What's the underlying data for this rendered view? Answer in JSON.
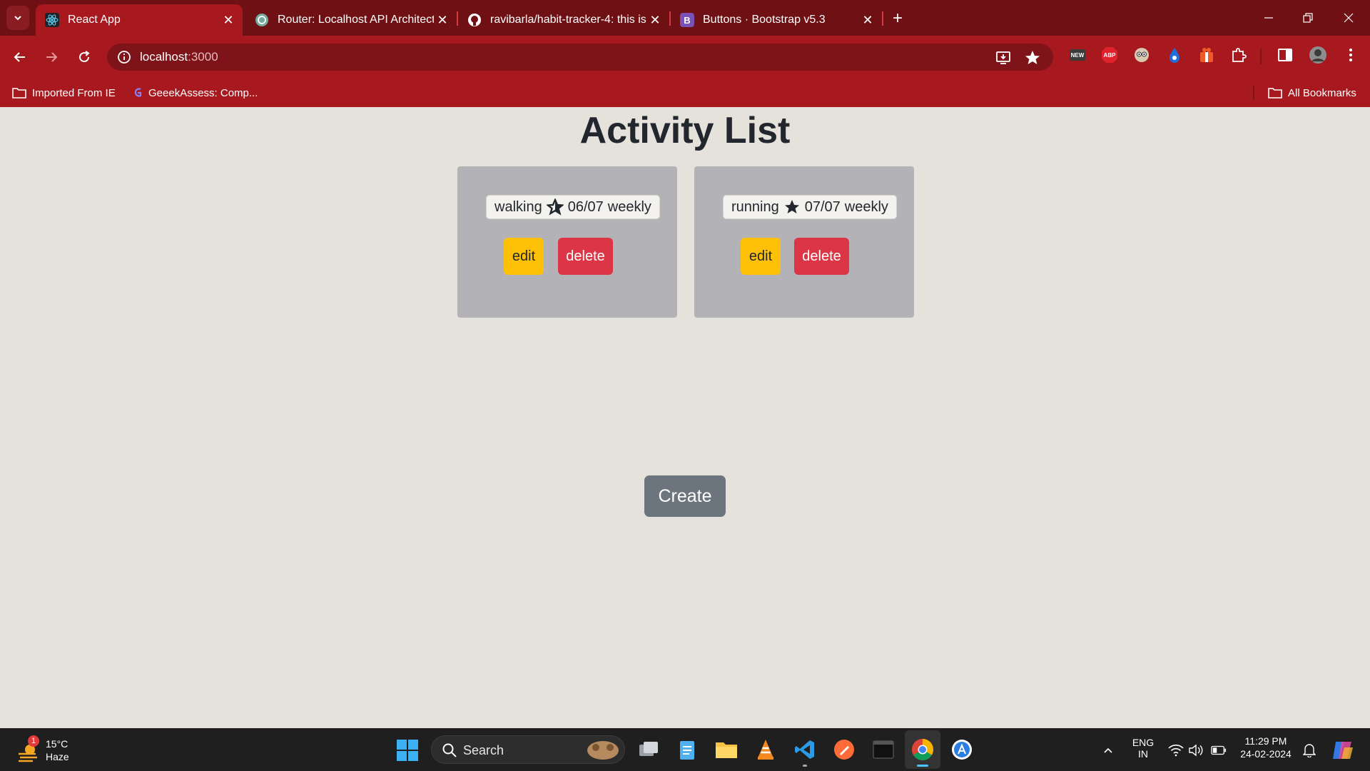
{
  "browser": {
    "tabs": [
      {
        "title": "React App",
        "active": true
      },
      {
        "title": "Router: Localhost API Architectu",
        "active": false
      },
      {
        "title": "ravibarla/habit-tracker-4: this is",
        "active": false
      },
      {
        "title": "Buttons · Bootstrap v5.3",
        "active": false
      }
    ],
    "url_host": "localhost",
    "url_port": ":3000",
    "bookmarks": [
      {
        "label": "Imported From IE"
      },
      {
        "label": "GeeekAssess: Comp..."
      }
    ],
    "all_bookmarks_label": "All Bookmarks",
    "ext_new_label": "NEW",
    "ext_abp_label": "ABP",
    "bootstrap_favicon_letter": "B"
  },
  "page": {
    "title": "Activity List",
    "activities": [
      {
        "name": "walking",
        "count": "06/07",
        "frequency": "weekly",
        "starred": false
      },
      {
        "name": "running",
        "count": "07/07",
        "frequency": "weekly",
        "starred": true
      }
    ],
    "edit_label": "edit",
    "delete_label": "delete",
    "create_label": "Create"
  },
  "taskbar": {
    "weather_temp": "15°C",
    "weather_desc": "Haze",
    "weather_badge": "1",
    "search_label": "Search",
    "lang_top": "ENG",
    "lang_bottom": "IN",
    "time": "11:29 PM",
    "date": "24-02-2024"
  },
  "colors": {
    "tabbar": "#6e1014",
    "toolbar": "#a8191f",
    "edit": "#ffc107",
    "delete": "#dc3545",
    "create": "#6c757d",
    "card": "#b3b2b6"
  }
}
